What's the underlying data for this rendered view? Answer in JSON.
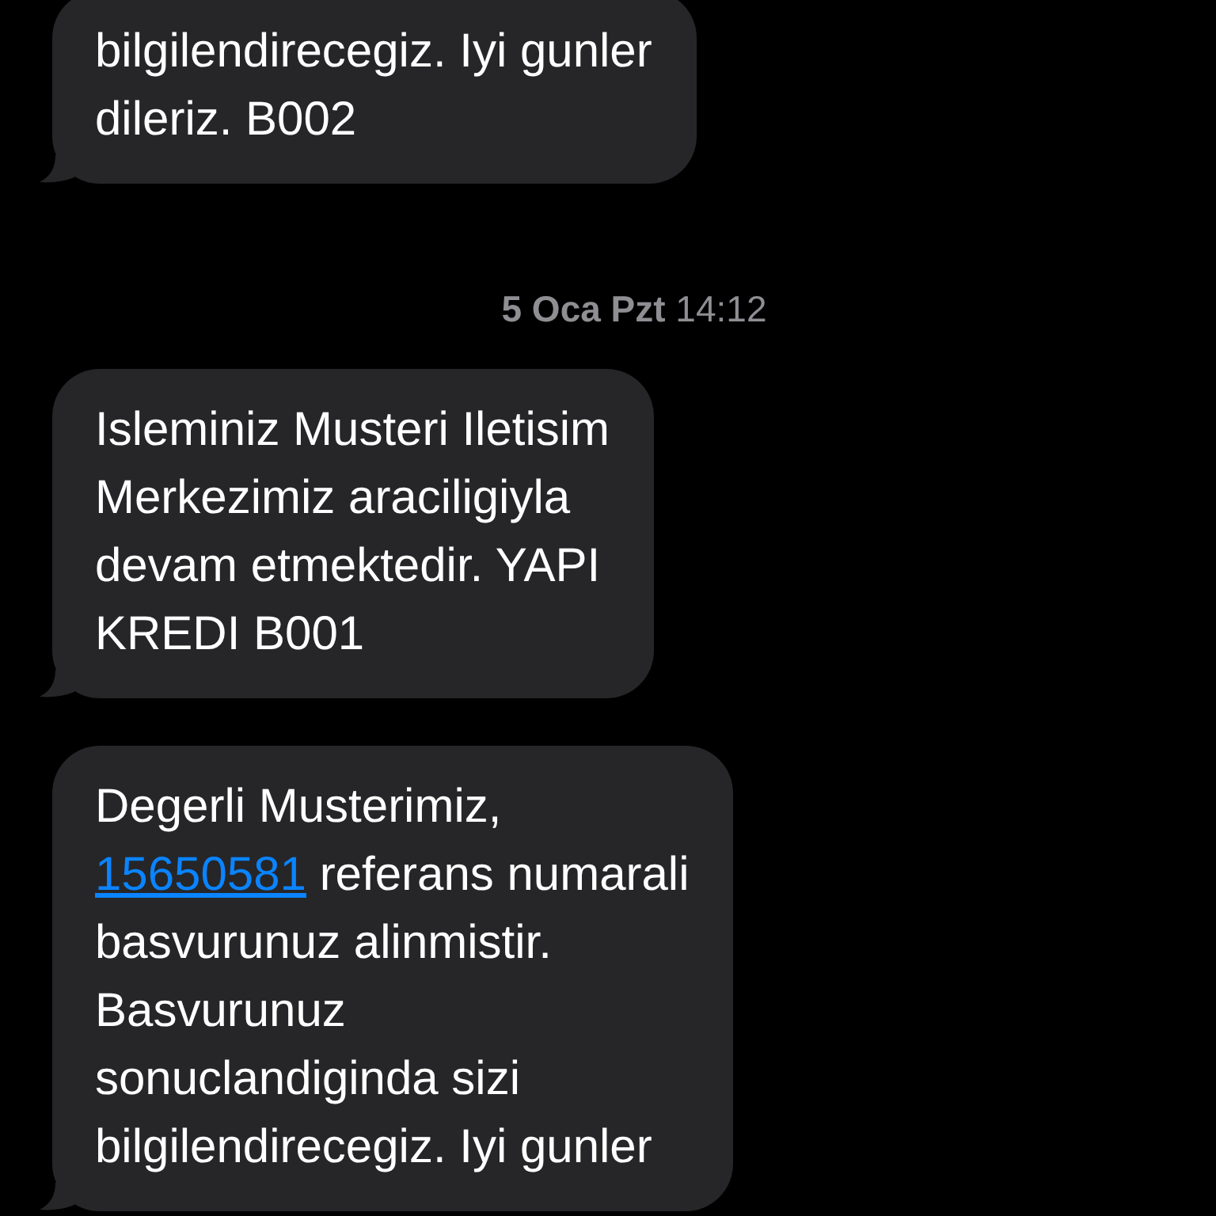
{
  "messages": [
    {
      "kind": "bubble",
      "lines": [
        [
          {
            "kind": "text",
            "text": "bilgilendirecegiz. Iyi gunler"
          }
        ],
        [
          {
            "kind": "text",
            "text": "dileriz. B002"
          }
        ]
      ]
    },
    {
      "kind": "timestamp",
      "text": "**5 Oca Pzt** 14:12"
    },
    {
      "kind": "bubble",
      "lines": [
        [
          {
            "kind": "text",
            "text": "Isleminiz Musteri Iletisim"
          }
        ],
        [
          {
            "kind": "text",
            "text": "Merkezimiz araciligiyla"
          }
        ],
        [
          {
            "kind": "text",
            "text": "devam etmektedir. YAPI"
          }
        ],
        [
          {
            "kind": "text",
            "text": "KREDI B001"
          }
        ]
      ]
    },
    {
      "kind": "bubble",
      "lines": [
        [
          {
            "kind": "text",
            "text": "Degerli Musterimiz,"
          }
        ],
        [
          {
            "kind": "link",
            "text": "15650581"
          },
          {
            "kind": "text",
            "text": " referans numarali"
          }
        ],
        [
          {
            "kind": "text",
            "text": "basvurunuz alinmistir."
          }
        ],
        [
          {
            "kind": "text",
            "text": "Basvurunuz"
          }
        ],
        [
          {
            "kind": "text",
            "text": "sonuclandiginda sizi"
          }
        ],
        [
          {
            "kind": "text",
            "text": "bilgilendirecegiz. Iyi gunler"
          }
        ]
      ]
    }
  ]
}
